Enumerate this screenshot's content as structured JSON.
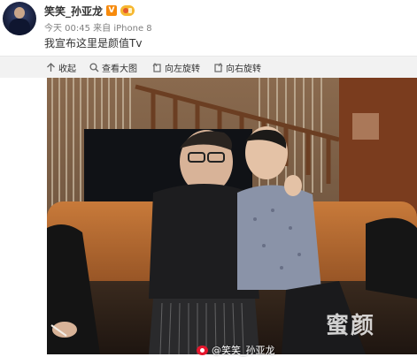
{
  "post": {
    "author": "笑笑_孙亚龙",
    "verified_badge": "V",
    "meta": "今天 00:45 来自 iPhone 8",
    "text": "我宣布这里是颜值Tv"
  },
  "actions": [
    {
      "label": "收起",
      "icon": "arrow-up-icon"
    },
    {
      "label": "查看大图",
      "icon": "search-icon"
    },
    {
      "label": "向左旋转",
      "icon": "rotate-left-icon"
    },
    {
      "label": "向右旋转",
      "icon": "rotate-right-icon"
    }
  ],
  "photo": {
    "credit": "@笑笑_孙亚龙",
    "watermark": "蜜颜"
  },
  "colors": {
    "verified": "#f78a0c",
    "meta_gray": "#808080",
    "action_bar_bg": "#f2f2f2",
    "weibo_red": "#e6162d"
  }
}
